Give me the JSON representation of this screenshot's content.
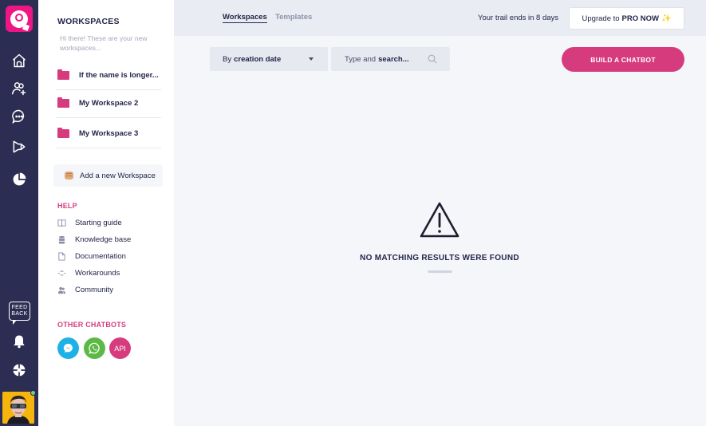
{
  "rail": {
    "logo": "chatbot-logo",
    "icons": [
      "home-icon",
      "add-user-icon",
      "chat-icon",
      "megaphone-icon",
      "pie-chart-icon"
    ],
    "feedback_label": "FEED BACK",
    "bottom_icons": [
      "bell-icon",
      "support-icon"
    ],
    "avatar_status": "online"
  },
  "panel": {
    "title": "WORKSPACES",
    "subtitle": "Hi there! These are your new workspaces...",
    "workspaces": [
      {
        "name": "If the name is longer..."
      },
      {
        "name": "My Workspace 2"
      },
      {
        "name": "My Workspace 3"
      }
    ],
    "add_workspace_label": "Add a new Workspace",
    "help_title": "HELP",
    "help_items": [
      {
        "label": "Starting guide",
        "icon": "book-icon"
      },
      {
        "label": "Knowledge base",
        "icon": "database-icon"
      },
      {
        "label": "Documentation",
        "icon": "document-icon"
      },
      {
        "label": "Workarounds",
        "icon": "workaround-icon"
      },
      {
        "label": "Community",
        "icon": "community-icon"
      }
    ],
    "other_chatbots_title": "OTHER CHATBOTS",
    "chatbots": [
      {
        "name": "messenger",
        "label": "",
        "color": "#1fb1e6"
      },
      {
        "name": "whatsapp",
        "label": "",
        "color": "#5cb946"
      },
      {
        "name": "api",
        "label": "API",
        "color": "#d63c7d"
      }
    ]
  },
  "topbar": {
    "tabs": [
      {
        "label": "Workspaces",
        "active": true
      },
      {
        "label": "Templates",
        "active": false
      }
    ],
    "trial_text": "Your trail ends in 8 days",
    "upgrade_prefix": "Upgrade to",
    "upgrade_bold": "PRO NOW",
    "upgrade_emoji": "✨"
  },
  "toolbar": {
    "sort_prefix": "By",
    "sort_value": "creation date",
    "search_placeholder_prefix": "Type and",
    "search_placeholder_bold": "search...",
    "build_label": "BUILD A CHATBOT"
  },
  "empty_state": {
    "icon": "warning-icon",
    "message": "NO MATCHING RESULTS WERE FOUND"
  },
  "colors": {
    "rail_bg": "#2c2d52",
    "brand_pink": "#ee1685",
    "accent": "#d63c7d",
    "text_dark": "#23254a"
  }
}
